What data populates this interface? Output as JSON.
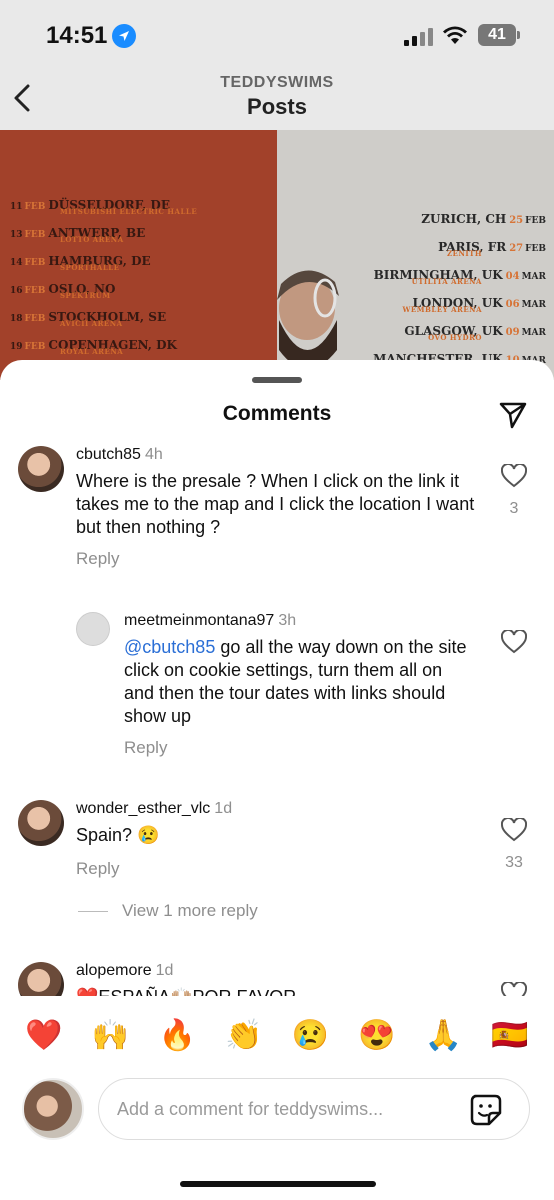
{
  "status_bar": {
    "time": "14:51",
    "battery": "41"
  },
  "header": {
    "account": "TEDDYSWIMS",
    "title": "Posts"
  },
  "poster": {
    "left_dates": [
      {
        "day": "11",
        "month": "FEB",
        "city": "DÜSSELDORF, DE",
        "venue": "MITSUBISHI ELECTRIC HALLE"
      },
      {
        "day": "13",
        "month": "FEB",
        "city": "ANTWERP, BE",
        "venue": "LOTTO ARENA"
      },
      {
        "day": "14",
        "month": "FEB",
        "city": "HAMBURG, DE",
        "venue": "SPORTHALLE"
      },
      {
        "day": "16",
        "month": "FEB",
        "city": "OSLO, NO",
        "venue": "SPEKTRUM"
      },
      {
        "day": "18",
        "month": "FEB",
        "city": "STOCKHOLM, SE",
        "venue": "AVICII ARENA"
      },
      {
        "day": "19",
        "month": "FEB",
        "city": "COPENHAGEN, DK",
        "venue": "ROYAL ARENA"
      }
    ],
    "right_dates": [
      {
        "city": "ZURICH, CH",
        "day": "25",
        "month": "FEB",
        "venue": "THE HALL"
      },
      {
        "city": "PARIS, FR",
        "day": "27",
        "month": "FEB",
        "venue": "ZENITH"
      },
      {
        "city": "BIRMINGHAM, UK",
        "day": "04",
        "month": "MAR",
        "venue": "UTILITA ARENA"
      },
      {
        "city": "LONDON, UK",
        "day": "06",
        "month": "MAR",
        "venue": "WEMBLEY ARENA"
      },
      {
        "city": "GLASGOW, UK",
        "day": "09",
        "month": "MAR",
        "venue": "OVO HYDRO"
      },
      {
        "city": "MANCHESTER, UK",
        "day": "10",
        "month": "MAR",
        "venue": ""
      }
    ]
  },
  "sheet": {
    "title": "Comments"
  },
  "comments": [
    {
      "user": "cbutch85",
      "time": "4h",
      "text": "Where is the presale ? When I click on the link it takes me to the map and I click the location I want but then nothing ?",
      "likes": "3",
      "reply": "Reply"
    },
    {
      "user": "meetmeinmontana97",
      "time": "3h",
      "mention": "@cbutch85",
      "text": " go all the way down on the site click on cookie settings, turn them all on and then the tour dates with links should show up",
      "reply": "Reply"
    },
    {
      "user": "wonder_esther_vlc",
      "time": "1d",
      "text": "Spain? 😢",
      "likes": "33",
      "reply": "Reply",
      "view_more": "View 1 more reply"
    },
    {
      "user": "alopemore",
      "time": "1d",
      "text": "❤️ESPAÑA🙌🏼POR FAVOR"
    }
  ],
  "reactions": [
    "❤️",
    "🙌",
    "🔥",
    "👏",
    "😢",
    "😍",
    "🙏",
    "🇪🇸"
  ],
  "composer": {
    "placeholder": "Add a comment for teddyswims..."
  },
  "colors": {
    "accent": "#2b6fd6",
    "location": "#1a8cff"
  }
}
